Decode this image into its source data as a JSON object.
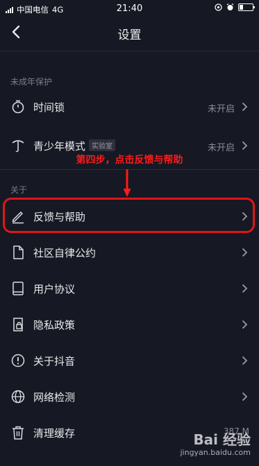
{
  "status_bar": {
    "carrier": "中国电信",
    "network": "4G",
    "time": "21:40"
  },
  "header": {
    "title": "设置"
  },
  "sections": {
    "minor": "未成年保护",
    "about": "关于"
  },
  "rows": {
    "time_lock": {
      "label": "时间锁",
      "value": "未开启"
    },
    "youth_mode": {
      "label": "青少年模式",
      "badge": "实验室",
      "value": "未开启"
    },
    "feedback": {
      "label": "反馈与帮助"
    },
    "community": {
      "label": "社区自律公约"
    },
    "agreement": {
      "label": "用户协议"
    },
    "privacy": {
      "label": "隐私政策"
    },
    "about_douyin": {
      "label": "关于抖音"
    },
    "network": {
      "label": "网络检测"
    },
    "cache": {
      "label": "清理缓存",
      "value": "387 M"
    }
  },
  "annotation": {
    "text": "第四步，点击反馈与帮助",
    "color": "#ff1a1a"
  },
  "watermark": {
    "brand": "Bai 经验",
    "url": "jingyan.baidu.com"
  },
  "colors": {
    "background": "#161823",
    "highlight": "#e01616"
  }
}
